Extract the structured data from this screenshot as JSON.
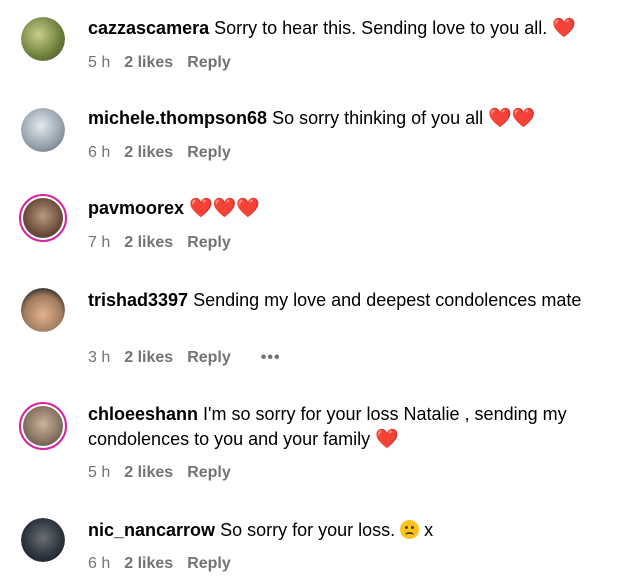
{
  "comments": [
    {
      "username": "cazzascamera",
      "text": "Sorry to hear this. Sending love to you all.",
      "emoji": "❤️",
      "time": "5 h",
      "likes": "2 likes",
      "reply": "Reply",
      "avatar_color": "#8a9a5b"
    },
    {
      "username": "michele.thompson68",
      "text": "So sorry thinking of you all",
      "emoji": "❤️❤️",
      "time": "6 h",
      "likes": "2 likes",
      "reply": "Reply",
      "avatar_color": "#9aa6b2"
    },
    {
      "username": "pavmoorex",
      "text": "",
      "emoji": "❤️❤️❤️",
      "time": "7 h",
      "likes": "2 likes",
      "reply": "Reply",
      "avatar_color": "#7a5a4a"
    },
    {
      "username": "trishad3397",
      "text": "Sending my love and deepest condolences mate",
      "emoji": "",
      "time": "3 h",
      "likes": "2 likes",
      "reply": "Reply",
      "more": "•••",
      "avatar_color": "#a07a5c"
    },
    {
      "username": "chloeeshann",
      "text": "I'm so sorry for your loss Natalie , sending my condolences to you and your family",
      "emoji": "❤️",
      "time": "5 h",
      "likes": "2 likes",
      "reply": "Reply",
      "avatar_color": "#8b7765"
    },
    {
      "username": "nic_nancarrow",
      "text": "So sorry for your loss.",
      "emoji_after": "x",
      "time": "6 h",
      "likes": "2 likes",
      "reply": "Reply",
      "avatar_color": "#2f3640"
    }
  ]
}
